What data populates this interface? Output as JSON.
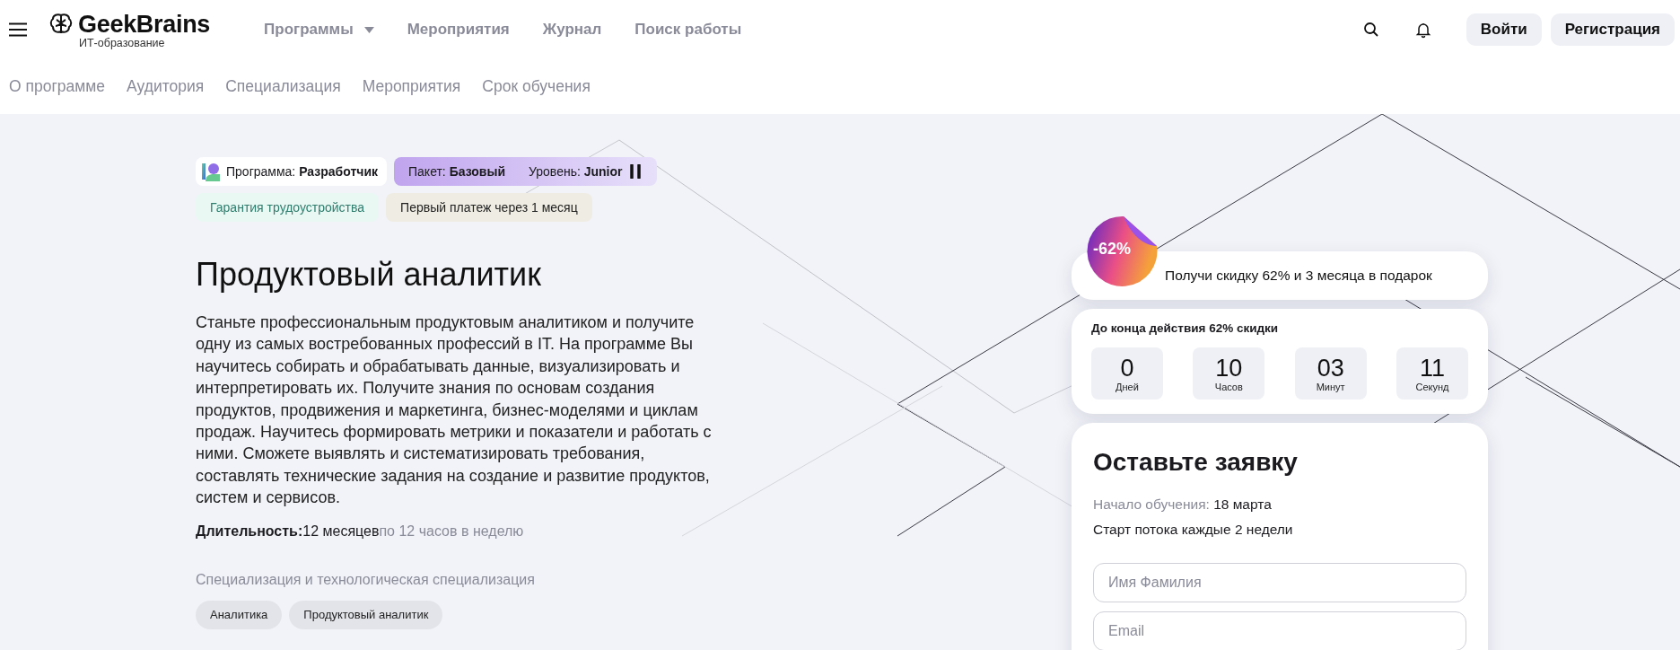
{
  "header": {
    "logo": {
      "name": "GeekBrains",
      "tagline": "ИТ-образование"
    },
    "nav": [
      {
        "label": "Программы",
        "has_dropdown": true
      },
      {
        "label": "Мероприятия",
        "has_dropdown": false
      },
      {
        "label": "Журнал",
        "has_dropdown": false
      },
      {
        "label": "Поиск работы",
        "has_dropdown": false
      }
    ],
    "buttons": [
      "Войти",
      "Регистрация"
    ]
  },
  "subnav": [
    "О программе",
    "Аудитория",
    "Специализация",
    "Мероприятия",
    "Срок обучения"
  ],
  "hero": {
    "program_badge": "Программа: **Разработчик**",
    "package_badge": {
      "package": "Пакет: **Базовый**",
      "level": "Уровень: **Junior**"
    },
    "tags": [
      {
        "kind": "guarantee",
        "label": "Гарантия трудоустройства"
      },
      {
        "kind": "payment",
        "label": "Первый платеж через 1 месяц"
      }
    ],
    "title": "Продуктовый аналитик",
    "description": "Станьте профессиональным продуктовым аналитиком и получите одну из самых востребованных профессий в IT. На программе Вы научитесь собирать и обрабатывать данные, визуализировать и интерпретировать их. Получите знания по основам создания продуктов, продвижения и маркетинга, бизнес-моделями и циклам продаж. Научитесь формировать метрики и показатели и работать с ними. Сможете выявлять и систематизировать требования, составлять технические задания на создание и развитие продуктов, систем и сервисов.",
    "duration": {
      "label": "Длительность:",
      "value": "12 месяцев",
      "note": "по 12 часов в неделю"
    },
    "specialization_label": "Специализация и технологическая специализация",
    "specializations": [
      "Аналитика",
      "Продуктовый аналитик"
    ]
  },
  "offer": {
    "discount": "-62%",
    "promo": "Получи скидку 62% и 3 месяца в подарок",
    "countdown_title": "До конца действия 62% скидки",
    "countdown": [
      {
        "value": "0",
        "unit": "Дней"
      },
      {
        "value": "10",
        "unit": "Часов"
      },
      {
        "value": "03",
        "unit": "Минут"
      },
      {
        "value": "11",
        "unit": "Секунд"
      }
    ],
    "form": {
      "title": "Оставьте заявку",
      "start": {
        "label": "Начало обучения:",
        "value": "18 марта"
      },
      "cadence": "Старт потока каждые 2 недели",
      "fields": [
        {
          "placeholder": "Имя Фамилия"
        },
        {
          "placeholder": "Email"
        }
      ]
    }
  }
}
